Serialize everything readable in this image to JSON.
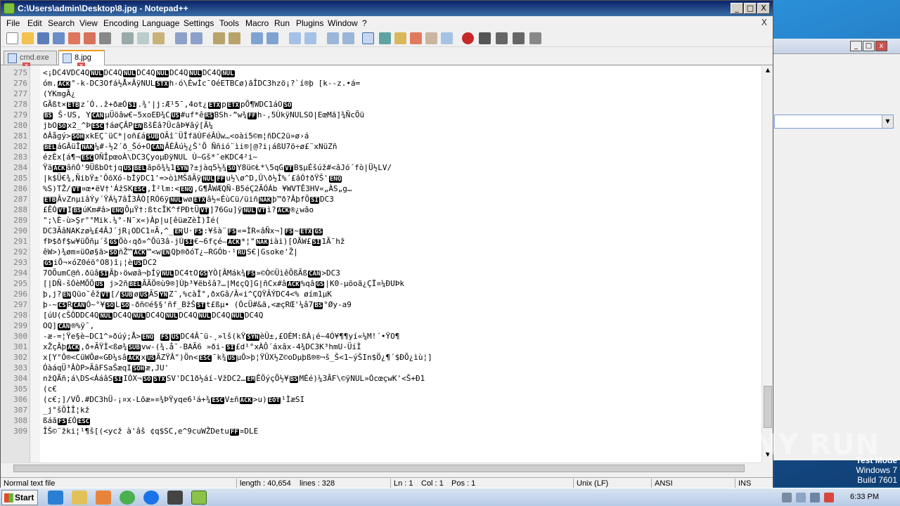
{
  "window": {
    "title": "C:\\Users\\admin\\Desktop\\8.jpg - Notepad++",
    "btn_min": "_",
    "btn_max": "□",
    "btn_close": "X"
  },
  "menu": {
    "items": [
      "File",
      "Edit",
      "Search",
      "View",
      "Encoding",
      "Language",
      "Settings",
      "Tools",
      "Macro",
      "Run",
      "Plugins",
      "Window",
      "?"
    ],
    "close": "X"
  },
  "tabs": [
    {
      "label": "cmd.exe",
      "close": "x"
    },
    {
      "label": "8.jpg",
      "close": "x"
    }
  ],
  "editor": {
    "lines": [
      {
        "n": "275",
        "t": "<¡",
        "c": [
          "DC4",
          "V",
          "DC4",
          "Q",
          "NUL",
          "DC4",
          "Q",
          "NUL",
          "DC4",
          "Q",
          "NUL",
          "DC4",
          "Q",
          "NUL",
          "DC4",
          "Q",
          "NUL"
        ]
      },
      {
        "n": "276",
        "t": "óm.",
        "c": [
          "ACK",
          "°-k-",
          "DC3",
          "Ofá½Å×ÂÿNUL",
          "STX",
          "h-ó\\ÈwÌc¯OéETBCø)ãÎ",
          "DC3",
          "hzö¡?`í®þ [k--z.•á="
        ]
      },
      {
        "n": "277",
        "t": "(YKmgÂ¿",
        "c": []
      },
      {
        "n": "278",
        "t": "GÃßt×",
        "c": [
          "ETB",
          "z´Ó..ž+ðæÓ",
          "SI",
          ".¾'|j:Æ¹5¯,4ot¿",
          "ETX",
          "p",
          "ETX",
          "pÕ¶",
          "W",
          "DC1",
          "áO",
          "SO"
        ]
      },
      {
        "n": "279",
        "t": "",
        "c": [
          "BS",
          " Š·US, Y",
          "CAN",
          "µÜöâw€~5xoEÐ¾C",
          "US",
          "#uf*ê",
          "RS",
          "BSh-”w¾",
          "FF",
          "h-,5ÙkÿNULSO|EœMã]¾ÑcÕü"
        ]
      },
      {
        "n": "280",
        "t": "jbO",
        "c": [
          "SO",
          "x2_^Þ",
          "ESC",
          "†áøÇÂP",
          "EN",
          "ßšÈâ?ÜcâÞ¥âý[Ã¼"
        ]
      },
      {
        "n": "281",
        "t": "ðÂågý>",
        "c": [
          "SOH",
          "xkEÇ¨üC*|oñ£á",
          "SUB",
          "OÃî¨ÜÎfäÙFéÂÚw…<oài5©m¦ñ",
          "DC2",
          "ü»ø›á"
        ]
      },
      {
        "n": "282",
        "t": "",
        "c": [
          "BEL",
          "áGÂüÎ",
          "NAK",
          "¼#-½2´ð_Šó+O",
          "CAN",
          "ÂÈÂú½¿Š'Õ Ññió¨ìi®|@?i¡áßU7ö÷ø£¨xNüZñ"
        ]
      },
      {
        "n": "283",
        "t": "ézÈx[á¶¬",
        "c": [
          "ESC",
          "OÑÎpœoÀ\\",
          "DC3",
          "ÇyoµÐÿNUL   Ù~Gš*¯eK",
          "DC4",
          "²i~"
        ]
      },
      {
        "n": "284",
        "t": "Ÿã",
        "c": [
          "ACK",
          "âñÓ'9ÜßbOtjq",
          "US",
          "BEL",
          "ãpõ¾¼1",
          "SYN",
          "?±jàq5½¾",
          "SO",
          "Y8ü©Ł*\\5qG",
          "VT",
          "B$µÉšúž#<âJó´fò|Ü½LV/"
        ]
      },
      {
        "n": "285",
        "t": "|k$Ü€¾,ÑibŸ±'ÔõXó-bÌÿ",
        "c": [
          "DC1",
          "'=>òìMŠãÃÿ",
          "NUL",
          "FF",
          "u½\\ø^D,Û\\ð½Î%´£âÓ†ðŸŠ'",
          "ENQ"
        ]
      },
      {
        "n": "286",
        "t": "%S)TŽ/",
        "c": [
          "VT",
          "¤œ•ëV†'ÁžSK",
          "ESC",
          ",Ì²lm:<",
          "ENQ",
          ",G¶ÅWÆQÑ-B5éÇ2ÃÓÁb ¥WV",
          "T",
          "Ê3HV«„ÀS„g…"
        ]
      },
      {
        "n": "287",
        "t": "",
        "c": [
          "ETB",
          "ÂvZnµiâÝy´ŸÁ¼7âÎ3ÂÒ[RÓ6ÿ",
          "NUL",
          "wø",
          "ETX",
          "â½«ÉùCü/üiñ",
          "NAK",
          "þ™ð?ÂþfÖ",
          "SI",
          "DC3"
        ]
      },
      {
        "n": "288",
        "t": "£ÊÒ",
        "c": [
          "VT",
          "I",
          "BS",
          "úKm#â>",
          "ENQ",
          "ÕµŸ†:ßtcÎK^fPÐtÜ",
          "VT",
          "]76Gu]ÿ",
          "NUL",
          "VT",
          "ì?",
          "ACK",
          "®¿wâo"
        ]
      },
      {
        "n": "289",
        "t": "\";\\È-ù>Şr°°Mik.¼°-N¯x«)Àp|u[êüæZèÌ)Ìé(",
        "c": []
      },
      {
        "n": "290",
        "t": "",
        "c": [
          "DC3",
          "ÃâNAKzø¼£4ÂJ´jR¡O",
          "DC1",
          "¤Ã,^_",
          "EM",
          "U·",
          "FS",
          ":¥šà¨",
          "FS",
          "«=ÌR«âÑx¬]",
          "FS",
          "~",
          "ETX",
          "GS"
        ]
      },
      {
        "n": "291",
        "t": "fÞ$ðf$w¥üÖñµ´š",
        "c": [
          "GS",
          "Öò‹qð»^Õü3â-jÙ",
          "SI",
          "€~6fçé–",
          "ACK",
          "*¦\"",
          "NAK",
          "iài)[OÃW£",
          "SI",
          "1Ã¯hž"
        ]
      },
      {
        "n": "292",
        "t": "êW>)¾øm¤üOø§ã>",
        "c": [
          "SO",
          "ñŽ™",
          "ACK",
          "™<w",
          "EN",
          "Qþ®ðóT¿–RGÓb·¹",
          "RU",
          "S€|Gsoke'Ž|"
        ]
      },
      {
        "n": "293",
        "t": "",
        "c": [
          "GS",
          "iÕ¬×óZ0éö°O8)î¡¦è",
          "US",
          "DC2"
        ]
      },
      {
        "n": "294",
        "t": "7OÕumC@ñ.ðüâ",
        "c": [
          "SI",
          "Ãþ›öwøâ¬þÍÿ",
          "NUL",
          "DC4",
          "tO",
          "GS",
          "YÒ[ÂMák¾",
          "FS",
          "»©Ò©ÜìêÕßÃß",
          "CAN",
          ">",
          "DC3"
        ]
      },
      {
        "n": "295",
        "t": "[|DÑ-šÓèMÕÖ",
        "c": [
          "US",
          "   j>2ñ",
          "BEL",
          "ÃÃÖ®ù9®]Ùþ³¥ëbšâ?…|M¢çQ]G|ñCx#â",
          "ACK",
          "%qâ",
          "GS",
          "|K0-µöoã¿ÇÏ¤¼ÐUÞk"
        ]
      },
      {
        "n": "296",
        "t": "þ,j?",
        "c": [
          "EN",
          "Qüo¯êž",
          "VT",
          "[/",
          "SUB",
          "ø",
          "US",
          "ÃS",
          "YN",
          "Z¯,%càÎ°,ðxGâ/Â«i^ÇQŸÃÝ",
          "DC4",
          "<% øím1µK"
        ]
      },
      {
        "n": "297",
        "t": "þ-~",
        "c": [
          "CS",
          "R",
          "CAN",
          "Ó~°¥",
          "SO",
          "L",
          "SO",
          "-ðñ©é§§'ñf_BžŠ",
          "ST",
          "t£ßµ•   (ÔcÜ#&ã,<æçRŒ'¼â7",
          "BS",
          "°Øy-a9"
        ]
      },
      {
        "n": "298",
        "t": "[úU(cŠÔD",
        "c": [
          "DC4",
          "Q",
          "NUL",
          "DC4",
          "Q",
          "NUL",
          "DC4",
          "Q",
          "NUL",
          "DC4",
          "Q",
          "NUL",
          "DC4",
          "Q",
          "NUL",
          "DC4",
          "Q"
        ]
      },
      {
        "n": "299",
        "t": "OQ]",
        "c": [
          "CAN",
          "®%ÿ¯,"
        ]
      },
      {
        "n": "300",
        "t": "-æ-=¦Ÿe§è~",
        "c": [
          "DC1",
          "^»ðúý;Å>",
          "ENQ",
          " ",
          "FS",
          "US",
          "DC4",
          "Â¯ü-¸»lš(kŸ",
          "SYN",
          "èÜ±,£OÈM:ßÀ¡é~4Ó¥¶¶yí«¼M!´•ŸO¶"
        ]
      },
      {
        "n": "301",
        "t": "xŽçÂþ",
        "c": [
          "ACK",
          ",ð+ÃŸÌ<ßø¾",
          "SUB",
          "vw-(¾.å¯-BAÃ6 »ði-",
          "SI",
          "£d¹°xÀÔ´áxâx-4¾",
          "DC3",
          "K³hmU-ÜíÌ"
        ]
      },
      {
        "n": "302",
        "t": "x[Y°Ô®<CüWÕø«GÐ¼sâ",
        "c": [
          "ACK",
          "x",
          "US",
          "ÃZŸÂ\")Ön<",
          "ESC",
          "¯k¾",
          "US",
          "µÔ>þ¦ŸÜX½Z©oDµþß®®¬š_Š<1~ýŠIn$Ö¿¶´$ÐÕ¿ìù¦]"
        ]
      },
      {
        "n": "303",
        "t": "ÓàáqÜ³ÂÒP>ÃâFSaŠæqI",
        "c": [
          "SOH",
          "æ,JU'"
        ]
      },
      {
        "n": "304",
        "t": "nžQÃñ;á\\DS<ÁáâS",
        "c": [
          "SI",
          "IÓX¬",
          "SO",
          "STX",
          "SV'",
          "DC1",
          "ð½áí-VžDC2…",
          "EM",
          "ÊÖýçÕ½¥",
          "BS",
          "MÉé)¼3ÃF\\©ÿNUL»ÓcœçwK'<Š+Ð1"
        ]
      },
      {
        "n": "305",
        "t": "(c€",
        "c": []
      },
      {
        "n": "306",
        "t": "(c€;]/VÕ.#",
        "c": [
          "DC3",
          "hÜ-¡¤x-Lõæ»¤¾ÞŸyqe6¹á+¾",
          "ESC",
          "V±ñ",
          "ACK",
          ">u)",
          "EOT",
          "¹ÌæSI"
        ]
      },
      {
        "n": "307",
        "t": "_j°šÕÌÎ¦kž",
        "c": []
      },
      {
        "n": "308",
        "t": "ßáã",
        "c": [
          "FS",
          "£Ó",
          "ESC"
        ]
      },
      {
        "n": "309",
        "t": "ÎŠ©¨žki¦¹¶š[(<ycž    à'âš     ¢q$SC,e^9cuWŽDetu",
        "c": [
          "FF",
          "¤DLE"
        ]
      }
    ]
  },
  "status": {
    "type": "Normal text file",
    "length": "length : 40,654",
    "lines": "lines : 328",
    "ln": "Ln : 1",
    "col": "Col : 1",
    "pos": "Pos : 1",
    "eol": "Unix (LF)",
    "encoding": "ANSI",
    "mode": "INS"
  },
  "watermark": "ANY RUN",
  "os": {
    "line1": "Test Mode",
    "line2": "Windows 7",
    "line3": "Build 7601"
  },
  "taskbar": {
    "start": "Start",
    "clock": "6:33 PM"
  },
  "colors": {
    "titlebar": "#0a246a",
    "tab_accent": "#f29b1d",
    "control_char_bg": "#000000",
    "gutter_text": "#808080"
  }
}
